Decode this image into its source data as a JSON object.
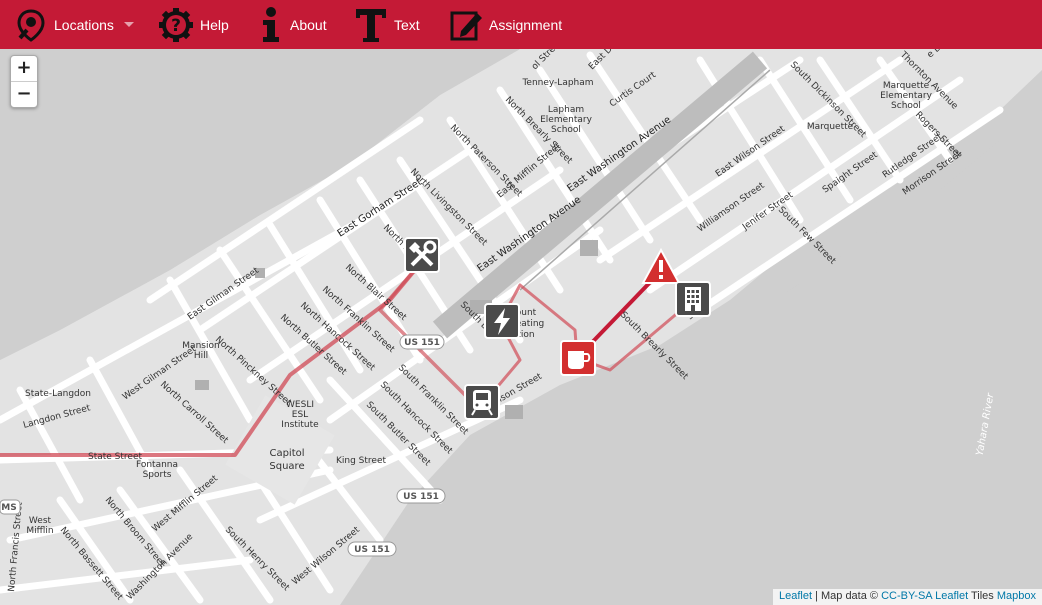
{
  "nav": {
    "locations": "Locations",
    "help": "Help",
    "about": "About",
    "text": "Text",
    "assignment": "Assignment"
  },
  "zoom": {
    "in": "+",
    "out": "−"
  },
  "attribution": {
    "leaflet": "Leaflet",
    "sep": " | Map data © ",
    "ccbysa": "CC-BY-SA",
    "leaflet2": "Leaflet",
    "tiles": " Tiles ",
    "mapbox": "Mapbox"
  },
  "colors": {
    "navbar": "#c41a36",
    "route": "#d04a55",
    "marker_dark": "#4a4a4a",
    "marker_red": "#d32f2f"
  },
  "streets": {
    "east_gorham": "East Gorham Street",
    "east_washington_1": "East Washington Avenue",
    "east_washington_2": "East Washington Avenue",
    "north_blair": "North Blair Street",
    "north_franklin": "North Franklin Street",
    "north_hancock": "North Hancock Street",
    "north_butler": "North Butler Street",
    "north_pinckney": "North Pinckney Street",
    "north_carroll": "North Carroll Street",
    "west_gilman": "West Gilman Street",
    "east_gilman": "East Gilman Street",
    "langdon": "Langdon Street",
    "state": "State Street",
    "king": "King Street",
    "south_franklin": "South Franklin Street",
    "south_hancock": "South Hancock Street",
    "south_butler": "South Butler Street",
    "south_henry": "South Henry Street",
    "west_wilson": "West Wilson Street",
    "west_mifflin": "West Mifflin Street",
    "north_broom": "North Broom Street",
    "north_bassett": "North Bassett Street",
    "washington_ave": "Washington Avenue",
    "north_francis": "North Francis Street",
    "north_livingston": "North Livingston Street",
    "north_paterson": "North Paterson Street",
    "north_brearly": "North Brearly Street",
    "east_mifflin": "East Mifflin Street",
    "williamson": "Williamson Street",
    "east_wilson": "East Wilson Street",
    "jenifer": "Jenifer Street",
    "south_few": "South Few Street",
    "spaight": "Spaight Street",
    "rutledge": "Rutledge Street",
    "morrison": "Morrison Street",
    "rogers": "Rogers Street",
    "south_dickinson": "South Dickinson Street",
    "thornton": "Thornton Avenue",
    "curtis": "Curtis Court",
    "east_dayton": "East Dayton",
    "north_bl": "North Bl",
    "south_bl": "South Bl",
    "son_street": "son Street",
    "south_brearly": "South Brearly Street",
    "erson_street": "erson Street",
    "sp_street": "Sp",
    "ol_street": "ol Street",
    "se_drive": "e Drive",
    "so_fragment": "So",
    "amson": "amson Street"
  },
  "places": {
    "tenney": "Tenney-Lapham",
    "lapham_1": "Lapham",
    "lapham_2": "Elementary",
    "lapham_3": "School",
    "marquette_school_1": "Marquette",
    "marquette_school_2": "Elementary",
    "marquette_school_3": "School",
    "marquette": "Marquette",
    "mansion_1": "Mansion",
    "mansion_2": "Hill",
    "state_langdon": "State-Langdon",
    "wesli_1": "WESLI",
    "wesli_2": "ESL",
    "wesli_3": "Institute",
    "capitol_1": "Capitol",
    "capitol_2": "Square",
    "fontanna_1": "Fontanna",
    "fontanna_2": "Sports",
    "west_mifflin_1": "West",
    "west_mifflin_2": "Mifflin",
    "mount_1": "ount",
    "mount_2": "eating",
    "mount_3": "tion",
    "yahara": "Yahara River"
  },
  "shields": {
    "us151_a": "US 151",
    "us151_b": "US 151",
    "us151_c": "US 151",
    "ms": "MS"
  }
}
